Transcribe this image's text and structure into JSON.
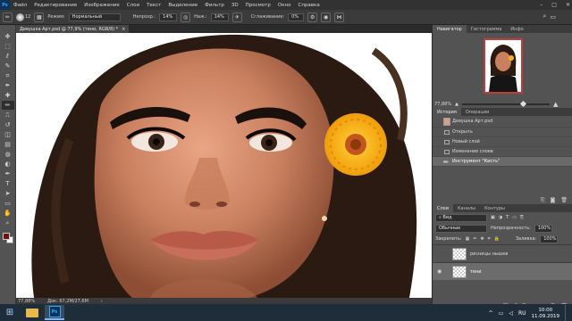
{
  "menubar": {
    "logo": "Ps",
    "items": [
      "Файл",
      "Редактирование",
      "Изображение",
      "Слои",
      "Текст",
      "Выделение",
      "Фильтр",
      "3D",
      "Просмотр",
      "Окно",
      "Справка"
    ],
    "controls": [
      "–",
      "□",
      "✕"
    ]
  },
  "options": {
    "brush_size": "12",
    "mode_label": "Режим:",
    "mode_value": "Нормальный",
    "opacity_label": "Непрозр.:",
    "opacity_value": "14%",
    "flow_label": "Наж.:",
    "flow_value": "14%",
    "smoothing_label": "Сглаживание:",
    "smoothing_value": "0%"
  },
  "document": {
    "tab_title": "Девушка Арт.psd @ 77,9% (тени, RGB/8) *",
    "tab_close": "×",
    "zoom": "77,88%",
    "doc_info": "Док: 67,2M/27,6M"
  },
  "tools": [
    "move-tool",
    "marquee-tool",
    "lasso-tool",
    "quick-select-tool",
    "crop-tool",
    "eyedropper-tool",
    "healing-tool",
    "brush-tool",
    "clone-stamp-tool",
    "history-brush-tool",
    "eraser-tool",
    "gradient-tool",
    "blur-tool",
    "dodge-tool",
    "pen-tool",
    "type-tool",
    "path-select-tool",
    "rectangle-tool",
    "hand-tool",
    "zoom-tool"
  ],
  "tool_glyphs": [
    "✥",
    "⬚",
    "ℓ",
    "✎",
    "⌗",
    "✒",
    "✚",
    "✏",
    "⎍",
    "↺",
    "◫",
    "▤",
    "◍",
    "◐",
    "✒",
    "T",
    "➤",
    "▭",
    "✋",
    "⌕"
  ],
  "colors": {
    "foreground": "#6b1410",
    "background": "#ffffff",
    "accent": "#31a8ff"
  },
  "navigator": {
    "tabs": [
      "Навигатор",
      "Гистограмма",
      "Инфо"
    ],
    "zoom": "77,88%"
  },
  "history": {
    "tabs": [
      "История",
      "Операции"
    ],
    "snapshot": "Девушка Арт.psd",
    "items": [
      "Открыть",
      "Новый слой",
      "Изменение слоев",
      "Инструмент \"Кисть\""
    ]
  },
  "layers": {
    "tabs": [
      "Слои",
      "Каналы",
      "Контуры"
    ],
    "filter_label": "Вид",
    "blend_mode": "Обычные",
    "opacity_label": "Непрозрачность:",
    "opacity_value": "100%",
    "lock_label": "Закрепить:",
    "fill_label": "Заливка:",
    "fill_value": "100%",
    "items": [
      {
        "name": "ресницы нышев"
      },
      {
        "name": "тени"
      }
    ]
  },
  "taskbar": {
    "lang": "RU",
    "time": "10:00",
    "date": "11.09.2019"
  }
}
